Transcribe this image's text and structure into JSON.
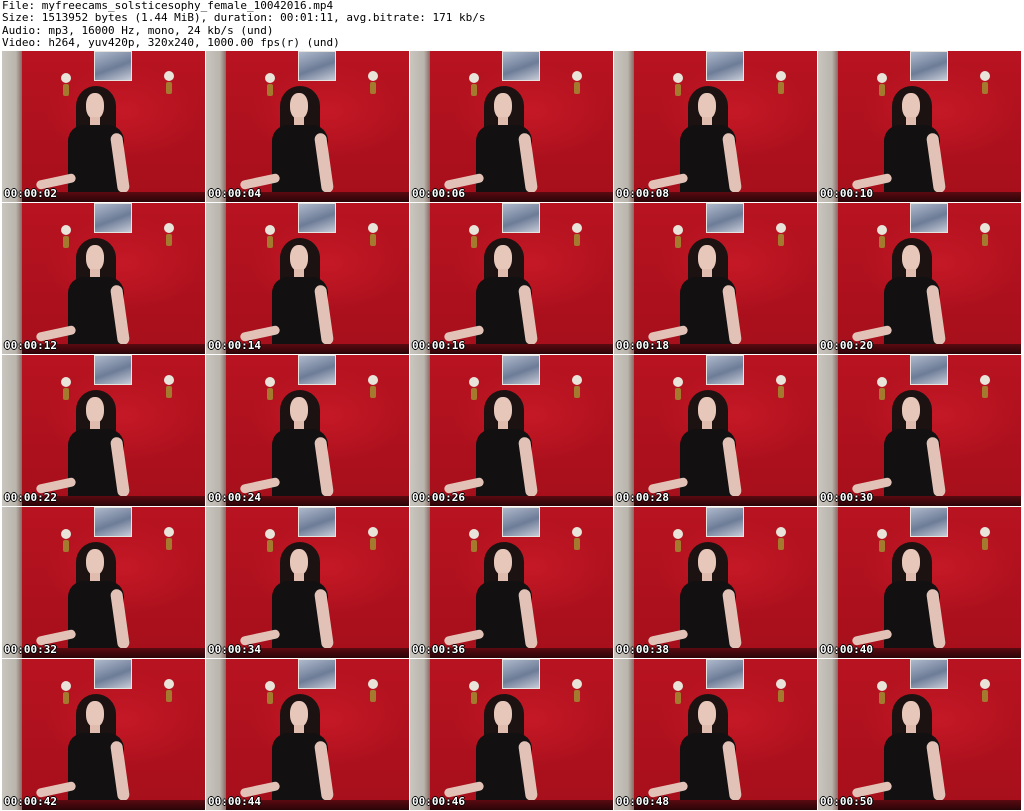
{
  "header": {
    "file_line": "File: myfreecams_solsticesophy_female_10042016.mp4",
    "size_line": "Size: 1513952 bytes (1.44 MiB), duration: 00:01:11, avg.bitrate: 171 kb/s",
    "audio_line": "Audio: mp3, 16000 Hz, mono, 24 kb/s (und)",
    "video_line": "Video: h264, yuv420p, 320x240, 1000.00 fps(r) (und)"
  },
  "thumbnails": [
    {
      "timestamp": "00:00:02"
    },
    {
      "timestamp": "00:00:04"
    },
    {
      "timestamp": "00:00:06"
    },
    {
      "timestamp": "00:00:08"
    },
    {
      "timestamp": "00:00:10"
    },
    {
      "timestamp": "00:00:12"
    },
    {
      "timestamp": "00:00:14"
    },
    {
      "timestamp": "00:00:16"
    },
    {
      "timestamp": "00:00:18"
    },
    {
      "timestamp": "00:00:20"
    },
    {
      "timestamp": "00:00:22"
    },
    {
      "timestamp": "00:00:24"
    },
    {
      "timestamp": "00:00:26"
    },
    {
      "timestamp": "00:00:28"
    },
    {
      "timestamp": "00:00:30"
    },
    {
      "timestamp": "00:00:32"
    },
    {
      "timestamp": "00:00:34"
    },
    {
      "timestamp": "00:00:36"
    },
    {
      "timestamp": "00:00:38"
    },
    {
      "timestamp": "00:00:40"
    },
    {
      "timestamp": "00:00:42"
    },
    {
      "timestamp": "00:00:44"
    },
    {
      "timestamp": "00:00:46"
    },
    {
      "timestamp": "00:00:48"
    },
    {
      "timestamp": "00:00:50"
    }
  ],
  "colors": {
    "background": "#ffffff",
    "wall_red": "#b3101c",
    "timestamp_text": "#ffffff"
  }
}
